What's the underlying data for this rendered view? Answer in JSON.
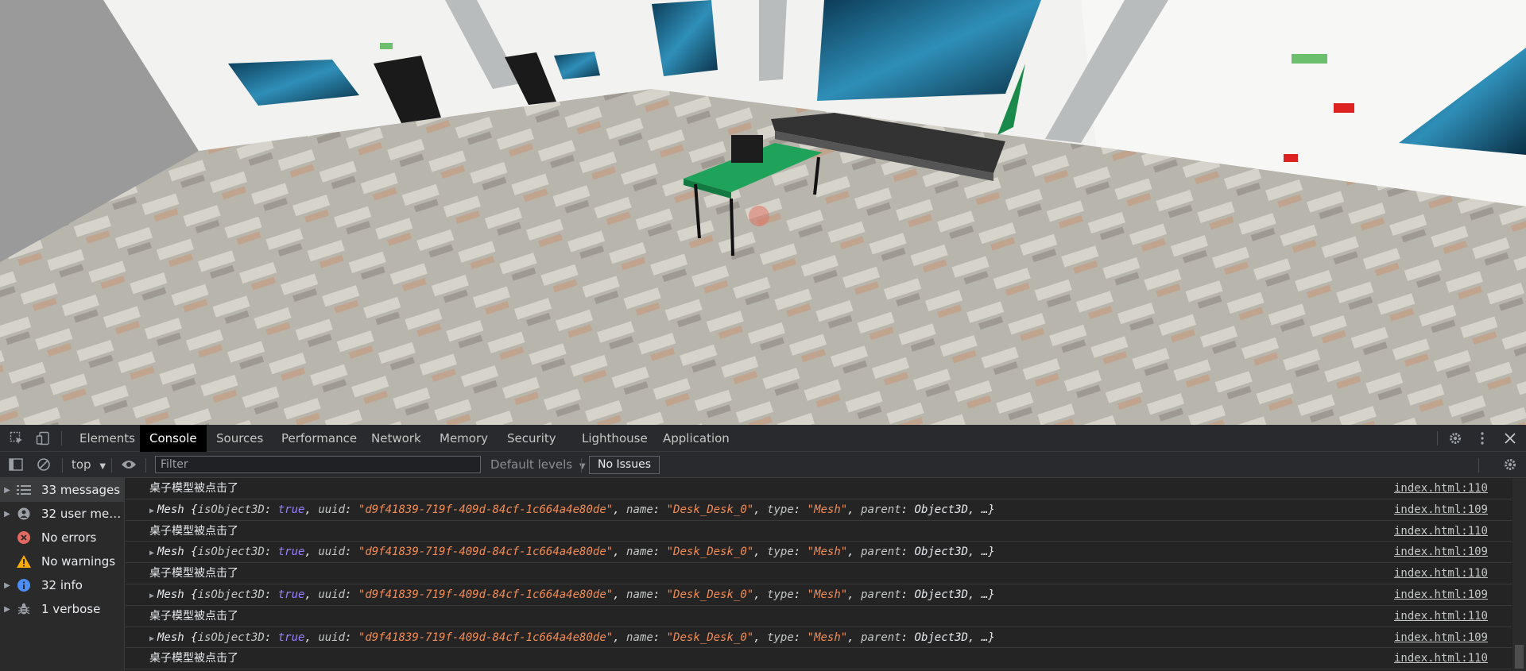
{
  "devtools": {
    "tabs": [
      "Elements",
      "Console",
      "Sources",
      "Performance",
      "Network",
      "Memory",
      "Security",
      "Lighthouse",
      "Application"
    ],
    "active_tab": "Console",
    "toolbar": {
      "context": "top",
      "filter_placeholder": "Filter",
      "levels": "Default levels",
      "issues": "No Issues"
    },
    "sidebar": [
      {
        "label": "33 messages",
        "icon": "list-icon",
        "expandable": true,
        "selected": true
      },
      {
        "label": "32 user mes...",
        "icon": "user-icon",
        "expandable": true
      },
      {
        "label": "No errors",
        "icon": "error-icon",
        "expandable": false
      },
      {
        "label": "No warnings",
        "icon": "warning-icon",
        "expandable": false
      },
      {
        "label": "32 info",
        "icon": "info-icon",
        "expandable": true
      },
      {
        "label": "1 verbose",
        "icon": "bug-icon",
        "expandable": true
      }
    ],
    "log": [
      {
        "type": "text",
        "text": "桌子模型被点击了",
        "source": "index.html:110"
      },
      {
        "type": "object",
        "source": "index.html:109"
      },
      {
        "type": "text",
        "text": "桌子模型被点击了",
        "source": "index.html:110"
      },
      {
        "type": "object",
        "source": "index.html:109"
      },
      {
        "type": "text",
        "text": "桌子模型被点击了",
        "source": "index.html:110"
      },
      {
        "type": "object",
        "source": "index.html:109"
      },
      {
        "type": "text",
        "text": "桌子模型被点击了",
        "source": "index.html:110"
      },
      {
        "type": "object",
        "source": "index.html:109"
      },
      {
        "type": "text",
        "text": "桌子模型被点击了",
        "source": "index.html:110"
      }
    ],
    "mesh_object": {
      "class": "Mesh",
      "isObject3D": "true",
      "uuid": "\"d9f41839-719f-409d-84cf-1c664a4e80de\"",
      "name": "\"Desk_Desk_0\"",
      "type": "\"Mesh\"",
      "parent": "Object3D",
      "more": "…}"
    }
  },
  "colors": {
    "devtools_bg": "#242424",
    "accent_blue": "#8ab4f8",
    "string_orange": "#f28b54",
    "bool_purple": "#9980ff",
    "desk_green": "#1fa35a"
  }
}
